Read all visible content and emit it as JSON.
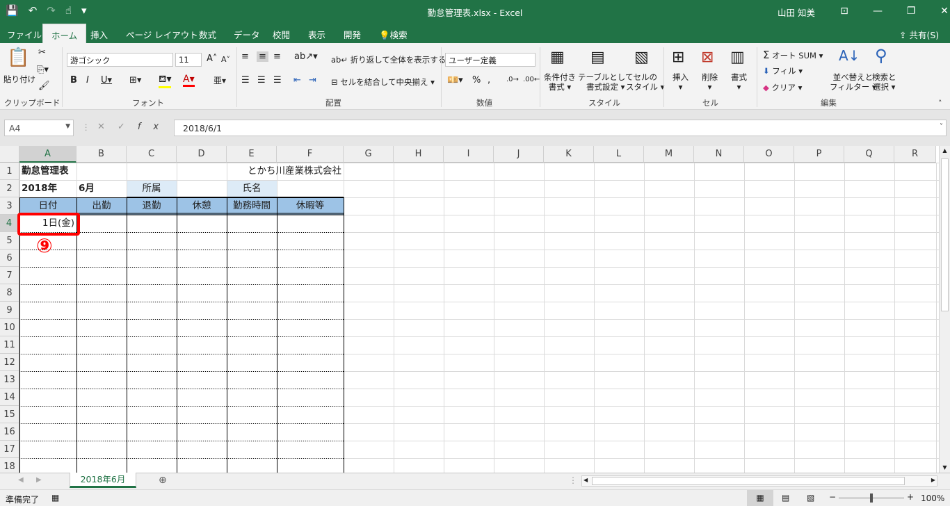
{
  "window": {
    "title": "勤怠管理表.xlsx  -  Excel",
    "user": "山田 知美"
  },
  "tabs": [
    "ファイル",
    "ホーム",
    "挿入",
    "ページ レイアウト",
    "数式",
    "データ",
    "校閲",
    "表示",
    "開発",
    "検索"
  ],
  "ribbon": {
    "clipboard": {
      "paste": "貼り付け",
      "label": "クリップボード"
    },
    "font": {
      "name": "游ゴシック",
      "size": "11",
      "label": "フォント"
    },
    "alignment": {
      "wrap": "折り返して全体を表示する",
      "merge": "セルを結合して中央揃え",
      "label": "配置"
    },
    "number": {
      "format": "ユーザー定義",
      "label": "数値"
    },
    "styles": {
      "conditional": [
        "条件付き",
        "書式"
      ],
      "table": [
        "テーブルとして",
        "書式設定"
      ],
      "cell": [
        "セルの",
        "スタイル"
      ],
      "label": "スタイル"
    },
    "cells": {
      "insert": "挿入",
      "delete": "削除",
      "format": "書式",
      "label": "セル"
    },
    "editing": {
      "autosum": "オート SUM",
      "fill": "フィル",
      "clear": "クリア",
      "sort": [
        "並べ替えと",
        "フィルター"
      ],
      "find": [
        "検索と",
        "選択"
      ],
      "label": "編集"
    }
  },
  "formula": {
    "namebox": "A4",
    "value": "2018/6/1"
  },
  "columns": [
    "A",
    "B",
    "C",
    "D",
    "E",
    "F",
    "G",
    "H",
    "I",
    "J",
    "K",
    "L",
    "M",
    "N",
    "O",
    "P",
    "Q",
    "R"
  ],
  "rows": [
    "1",
    "2",
    "3",
    "4",
    "5",
    "6",
    "7",
    "8",
    "9",
    "10",
    "11",
    "12",
    "13",
    "14",
    "15",
    "16",
    "17",
    "18"
  ],
  "sheet": {
    "a1": "勤怠管理表",
    "e1": "とかち川産業株式会社",
    "a2": "2018年",
    "b2": "6月",
    "c2": "所属",
    "e2": "氏名",
    "headers": [
      "日付",
      "出勤",
      "退勤",
      "休憩",
      "勤務時間",
      "休暇等"
    ],
    "a4": "1日(金)"
  },
  "annotation": "⑨",
  "sheet_tab": "2018年6月",
  "status": {
    "ready": "準備完了",
    "zoom": "100%"
  },
  "share": "共有(S)",
  "colors": {
    "accent": "#217346",
    "header_fill": "#9dc3e6",
    "label_fill": "#ddebf7",
    "highlight": "#ff0000"
  }
}
